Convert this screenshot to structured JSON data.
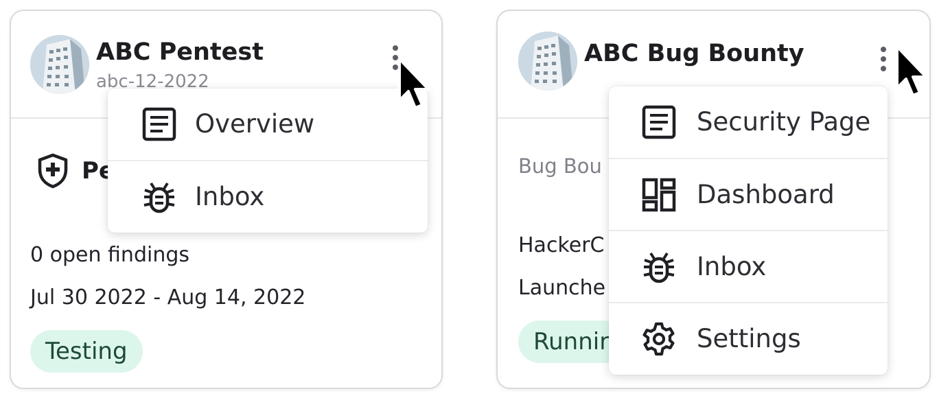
{
  "cards": [
    {
      "title": "ABC Pentest",
      "subtitle": "abc-12-2022",
      "label": "Pe",
      "findings": "0 open findings",
      "dates": "Jul 30 2022 - Aug 14, 2022",
      "status": "Testing",
      "menu": [
        {
          "label": "Overview",
          "icon": "document-icon"
        },
        {
          "label": "Inbox",
          "icon": "bug-icon"
        }
      ]
    },
    {
      "title": "ABC Bug Bounty",
      "type_label": "Bug Bou",
      "line1": "HackerC",
      "line2": "Launche",
      "status": "Runnir",
      "menu": [
        {
          "label": "Security Page",
          "icon": "document-icon"
        },
        {
          "label": "Dashboard",
          "icon": "dashboard-icon"
        },
        {
          "label": "Inbox",
          "icon": "bug-icon"
        },
        {
          "label": "Settings",
          "icon": "gear-icon"
        }
      ]
    }
  ],
  "colors": {
    "badge_bg": "#ddf6ec",
    "badge_text": "#1e4a35",
    "border": "#d9d9de",
    "muted": "#8a8a93"
  }
}
